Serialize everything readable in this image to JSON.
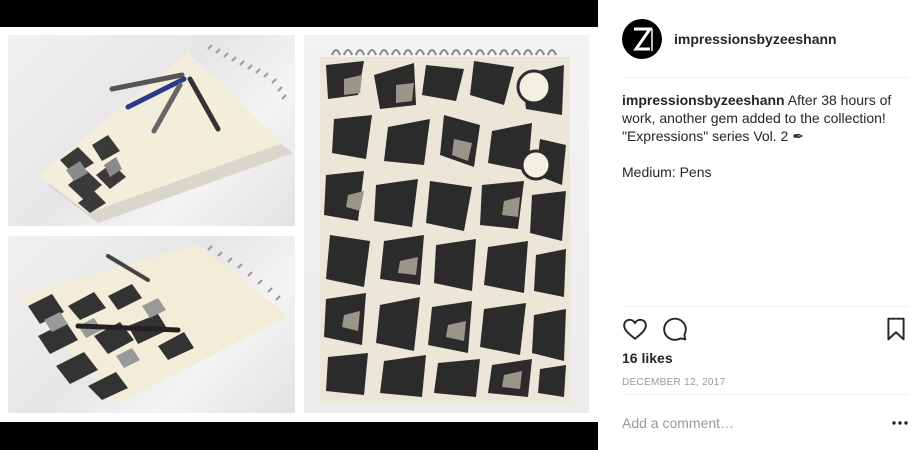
{
  "post": {
    "username": "impressionsbyzeeshann",
    "avatar_letter": "Z",
    "caption_user": "impressionsbyzeeshann",
    "caption_text": "After 38 hours of work, another gem added to the collection! \"Expressions\" series Vol. 2 ✒",
    "caption_medium": "Medium: Pens",
    "likes": "16 likes",
    "date": "DECEMBER 12, 2017",
    "comment_placeholder": "Add a comment…"
  },
  "icons": {
    "like": "heart-icon",
    "comment": "comment-icon",
    "save": "bookmark-icon",
    "more": "more-options-icon"
  },
  "colors": {
    "text": "#262626",
    "muted": "#999999",
    "divider": "#efefef",
    "media_background": "#000000"
  }
}
